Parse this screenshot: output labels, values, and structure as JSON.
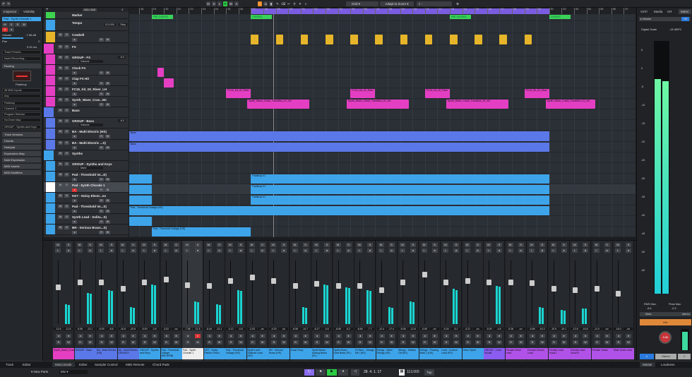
{
  "toolbar": {
    "modes": [
      "M",
      "S",
      "L",
      "R",
      "W",
      "A"
    ],
    "snap": "Grid",
    "quantize": "Adapt to Zoom",
    "search_value": "-"
  },
  "inspector": {
    "tabs": [
      "Inspector",
      "Visibility"
    ],
    "track_name": "Pad - Synth Chorale 1",
    "volume_label": "Volume",
    "volume_value": "-7.98 dB",
    "pan_label": "Pan",
    "pan_value": "C",
    "delay_value": "0.00 ms",
    "track_presets": "Track Presets...",
    "insert_recording": "Insert Recording...",
    "routing": "Routing",
    "instrument": "Padshop",
    "midi_input": "All MIDI Inputs",
    "input_sub": "Any",
    "output": "Padshop",
    "channel": "Channel 1",
    "program": "Program Selector",
    "drum_map": "No Drum Map",
    "group_out": "GROUP - Synths and Keys",
    "sections": [
      "Track Versions",
      "Chords",
      "Notepad",
      "Expression Map",
      "Note Expression",
      "MIDI Inserts",
      "MIDI Modifiers"
    ]
  },
  "tracklist": {
    "counter": "101 / 102",
    "tempo_value": "113.000",
    "tempo_mode": "Step",
    "tracks": [
      {
        "name": "Marker",
        "color": "#3dd24f",
        "kind": "marker"
      },
      {
        "name": "Tempo",
        "color": "#3ea4ea",
        "kind": "tempo"
      },
      {
        "name": "Cowbell",
        "color": "#e6b52a",
        "kind": "audio"
      },
      {
        "name": "FX",
        "color": "#e43fc3",
        "kind": "folder"
      },
      {
        "name": "GROUP - FX",
        "color": "#e43fc3",
        "kind": "group",
        "vol": "-6.0",
        "auto": "Volume"
      },
      {
        "name": "Clock FX",
        "color": "#e43fc3",
        "kind": "audio"
      },
      {
        "name": "Clap FX Hit",
        "color": "#e43fc3",
        "kind": "audio"
      },
      {
        "name": "FC15_Kit_02_Riser_LH",
        "color": "#e43fc3",
        "kind": "audio"
      },
      {
        "name": "Synth_Wave_Cras...NC",
        "color": "#e43fc3",
        "kind": "audio"
      },
      {
        "name": "Bass",
        "color": "#5b78e8",
        "kind": "folder"
      },
      {
        "name": "GROUP - Bass",
        "color": "#5b78e8",
        "kind": "group",
        "vol": "-6.0",
        "auto": "Volume"
      },
      {
        "name": "BA - Multi Electric (HS)",
        "color": "#5b78e8",
        "kind": "inst"
      },
      {
        "name": "BA - Multi Electric ...S)",
        "color": "#5b78e8",
        "kind": "inst"
      },
      {
        "name": "Synths",
        "color": "#3ea4ea",
        "kind": "folder"
      },
      {
        "name": "GROUP - Synths and Keys",
        "color": "#3ea4ea",
        "kind": "group",
        "auto": "Mute"
      },
      {
        "name": "Pad - Threshold Vo...E)",
        "color": "#3ea4ea",
        "kind": "inst"
      },
      {
        "name": "Pad - Synth Chorale 1",
        "color": "#ffffff",
        "kind": "inst",
        "selected": true
      },
      {
        "name": "KEY - Noisy Electr...no",
        "color": "#3ea4ea",
        "kind": "inst"
      },
      {
        "name": "Pad - Threshold Vo...S)",
        "color": "#3ea4ea",
        "kind": "inst"
      },
      {
        "name": "Synth Lead - Solitu...S)",
        "color": "#3ea4ea",
        "kind": "inst"
      },
      {
        "name": "BR - Serious Brass...S)",
        "color": "#3ea4ea",
        "kind": "inst"
      }
    ]
  },
  "ruler": {
    "first_bar": 18,
    "last_bar": 57,
    "cycle": [
      27,
      51
    ]
  },
  "markers": [
    {
      "label": "PRE-CHORUS",
      "bar": 19
    },
    {
      "label": "CHORUS",
      "bar": 27
    },
    {
      "label": "PRE-CHORUS",
      "bar": 43
    },
    {
      "label": "CHORUS",
      "bar": 51
    }
  ],
  "events": [
    {
      "track": 2,
      "start": 27,
      "end": 27.6,
      "label": "",
      "repeat": 12,
      "step": 2
    },
    {
      "track": 5,
      "start": 19.5,
      "end": 20,
      "label": ""
    },
    {
      "track": 6,
      "start": 20,
      "end": 20.8,
      "label": ""
    },
    {
      "track": 7,
      "start": 25,
      "end": 27,
      "label": "FC15_Kit_02_Riser"
    },
    {
      "track": 7,
      "start": 35,
      "end": 37,
      "label": "FC15_Kit_02_Riser"
    },
    {
      "track": 7,
      "start": 41,
      "end": 43,
      "label": "FC15_Kit_02_Riser"
    },
    {
      "track": 7,
      "start": 49,
      "end": 51,
      "label": "FC15_Kit_02_Riser"
    },
    {
      "track": 8,
      "start": 26.7,
      "end": 31.7,
      "label": "Synth_Wave_Crash_Transition_01_NC"
    },
    {
      "track": 8,
      "start": 34.7,
      "end": 39.7,
      "label": "Synth_Wave_Crash_Transition_01_NC"
    },
    {
      "track": 8,
      "start": 42.7,
      "end": 47.7,
      "label": "Synth_Wave_Crash_Transition_01_NC"
    },
    {
      "track": 8,
      "start": 50.7,
      "end": 54.7,
      "label": "Synth_Wave_Crash_Transition_01_NC"
    },
    {
      "track": 11,
      "start": 17.2,
      "end": 51,
      "label": "Bass"
    },
    {
      "track": 12,
      "start": 17.2,
      "end": 51,
      "label": "Bass"
    },
    {
      "track": 15,
      "start": 17.2,
      "end": 19,
      "label": ""
    },
    {
      "track": 15,
      "start": 27,
      "end": 51,
      "label": "Padshop 01"
    },
    {
      "track": 16,
      "start": 17.2,
      "end": 19,
      "label": ""
    },
    {
      "track": 16,
      "start": 27,
      "end": 51,
      "label": "Padshop 01"
    },
    {
      "track": 17,
      "start": 17.2,
      "end": 19,
      "label": ""
    },
    {
      "track": 17,
      "start": 27,
      "end": 51,
      "label": "Padshop 01"
    },
    {
      "track": 18,
      "start": 17.2,
      "end": 51,
      "label": "Pad - Threshold Voltage (HS)"
    },
    {
      "track": 19,
      "start": 17.2,
      "end": 19,
      "label": ""
    },
    {
      "track": 20,
      "start": 19,
      "end": 27,
      "label": "Pad - Threshold Voltage (HS)"
    }
  ],
  "mixer": {
    "channels": [
      {
        "name": "Synth_Wave_Crash_Transition_01",
        "color": "#e43fc3",
        "db": "-11.6",
        "peak": "-11.6",
        "fader": 0.62,
        "level": 0.35
      },
      {
        "name": "GROUP - Bass",
        "color": "#5b78e8",
        "db": "-5.06",
        "peak": "-13.1",
        "fader": 0.7,
        "level": 0.55
      },
      {
        "name": "BA - Multi Electric (HS)",
        "color": "#5b78e8",
        "db": "-5.09",
        "peak": "-8.6",
        "fader": 0.7,
        "level": 0.6
      },
      {
        "name": "BA - Multi Electric CRUNCH",
        "color": "#5b78e8",
        "db": "-10.6",
        "peak": "-20.6",
        "fader": 0.6,
        "level": 0.3
      },
      {
        "name": "GROUP - Synths and Keys",
        "color": "#3ea4ea",
        "db": "-5.00",
        "peak": "-3.8",
        "fader": 0.7,
        "level": 0.7
      },
      {
        "name": "Pad - Threshold Voltage (REVERB)",
        "color": "#3ea4ea",
        "db": "-3.02",
        "peak": "-oo",
        "fader": 0.75,
        "level": 0
      },
      {
        "name": "Pad - Synth Chorale 1",
        "color": "#eeeeee",
        "db": "-7.98",
        "peak": "-11.8",
        "fader": 0.66,
        "level": 0.4,
        "selected": true
      },
      {
        "name": "KEY - Noisy Electric Piano",
        "color": "#3ea4ea",
        "db": "-8.44",
        "peak": "-13.1",
        "fader": 0.65,
        "level": 0.35
      },
      {
        "name": "Pad - Threshold Voltage (HS)",
        "color": "#3ea4ea",
        "db": "-4.12",
        "peak": "-4.8",
        "fader": 0.72,
        "level": 0.6
      },
      {
        "name": "Synth Lead - Solitude Lead (HS)",
        "color": "#3ea4ea",
        "db": "-2.03",
        "peak": "-oo",
        "fader": 0.78,
        "level": 0
      },
      {
        "name": "BR - Serious Brass (HS)",
        "color": "#3ea4ea",
        "db": "-4.20",
        "peak": "-oo",
        "fader": 0.72,
        "level": 0
      },
      {
        "name": "Vocal Chop",
        "color": "#3ea4ea",
        "db": "-8.56",
        "peak": "-14.7",
        "fader": 0.65,
        "level": 0.3
      },
      {
        "name": "Synth Brass - Analog Brass (PL)",
        "color": "#3ea4ea",
        "db": "-6.17",
        "peak": "-4.6",
        "fader": 0.68,
        "level": 0.7
      },
      {
        "name": "Synth Brass - Ultra Brass (PL)",
        "color": "#3ea4ea",
        "db": "-8.89",
        "peak": "-6.2",
        "fader": 0.64,
        "level": 0.65
      },
      {
        "name": "E.Piano - Vintage Mk I (HS)",
        "color": "#3ea4ea",
        "db": "-8.84",
        "peak": "-7.7",
        "fader": 0.64,
        "level": 0.6
      },
      {
        "name": "Strings - Mello Strings (HS)",
        "color": "#3ea4ea",
        "db": "-12.4",
        "peak": "-17.4",
        "fader": 0.58,
        "level": 0.3
      },
      {
        "name": "Strings - Mellow Ott (HS)",
        "color": "#3ea4ea",
        "db": "-5.06",
        "peak": "-12.8",
        "fader": 0.7,
        "level": 0.4
      },
      {
        "name": "Strings - Phasing Mark 1 (HS)",
        "color": "#3ea4ea",
        "db": "-0.60",
        "peak": "-oo",
        "fader": 0.82,
        "level": 0
      },
      {
        "name": "Lead - Custom Lead (PS)",
        "color": "#3ea4ea",
        "db": "-5.34",
        "peak": "-6.1",
        "fader": 0.7,
        "level": 0.62
      },
      {
        "name": "Outro Synth",
        "color": "#3ea4ea",
        "db": "-4.21",
        "peak": "-oo",
        "fader": 0.72,
        "level": 0
      },
      {
        "name": "GROUP - Lead Vocals",
        "color": "#8a5cf0",
        "db": "-5.00",
        "peak": "-4.6",
        "fader": 0.7,
        "level": 0.68
      },
      {
        "name": "Female Verse Lead",
        "color": "#b052e8",
        "db": "-5.28",
        "peak": "-oo",
        "fader": 0.7,
        "level": 0
      },
      {
        "name": "Female Chorus Lead",
        "color": "#b052e8",
        "db": "-5.56",
        "peak": "-16.3",
        "fader": 0.69,
        "level": 0.3
      },
      {
        "name": "Female Lead Vocal L",
        "color": "#b052e8",
        "db": "-10.5",
        "peak": "-19.1",
        "fader": 0.6,
        "level": 0.25
      },
      {
        "name": "Female Lead Vocal R",
        "color": "#b052e8",
        "db": "-12.8",
        "peak": "-16.8",
        "fader": 0.58,
        "level": 0.28
      },
      {
        "name": "Female Yeahs",
        "color": "#b052e8",
        "db": "-11.0",
        "peak": "-oo",
        "fader": 0.6,
        "level": 0
      },
      {
        "name": "Male Verse Lead",
        "color": "#b052e8",
        "db": "-16.0",
        "peak": "-oo",
        "fader": 0.52,
        "level": 0
      }
    ]
  },
  "right": {
    "tabs": [
      "VSTi",
      "Media",
      "CR",
      "Meter"
    ],
    "master": "Master",
    "master_btn": "Off",
    "digital_scale": "Digital Scale",
    "digital_value": "-18 dBFS",
    "scale": [
      "6",
      "0",
      "-5",
      "-10",
      "-15",
      "-20",
      "-25",
      "-30",
      "-35",
      "-40",
      "-45",
      "-50",
      "-60"
    ],
    "rms_label": "RMS Max.",
    "rms": "-8.6",
    "peak_label": "Peak Max.",
    "peak": "-0.3",
    "main": "Main",
    "main_mode": "stereo",
    "mix": "Mix",
    "knob": "-5.68",
    "a": "A",
    "stereo": "Stereo",
    "one": "1",
    "bottom_tabs": [
      "Master",
      "Loudness"
    ],
    "meter_l": 0.85,
    "meter_r": 0.84
  },
  "bottom": {
    "left_tabs": [
      "Track",
      "Editor"
    ],
    "tabs": [
      "MixConsole",
      "Editor",
      "Sampler Control",
      "MIDI Remote",
      "Chord Pads"
    ]
  },
  "transport": {
    "new_parts": "New Parts",
    "mix": "Mix",
    "position": "28. 4. 1. 17",
    "tempo": "113.000",
    "tap": "Tap"
  }
}
